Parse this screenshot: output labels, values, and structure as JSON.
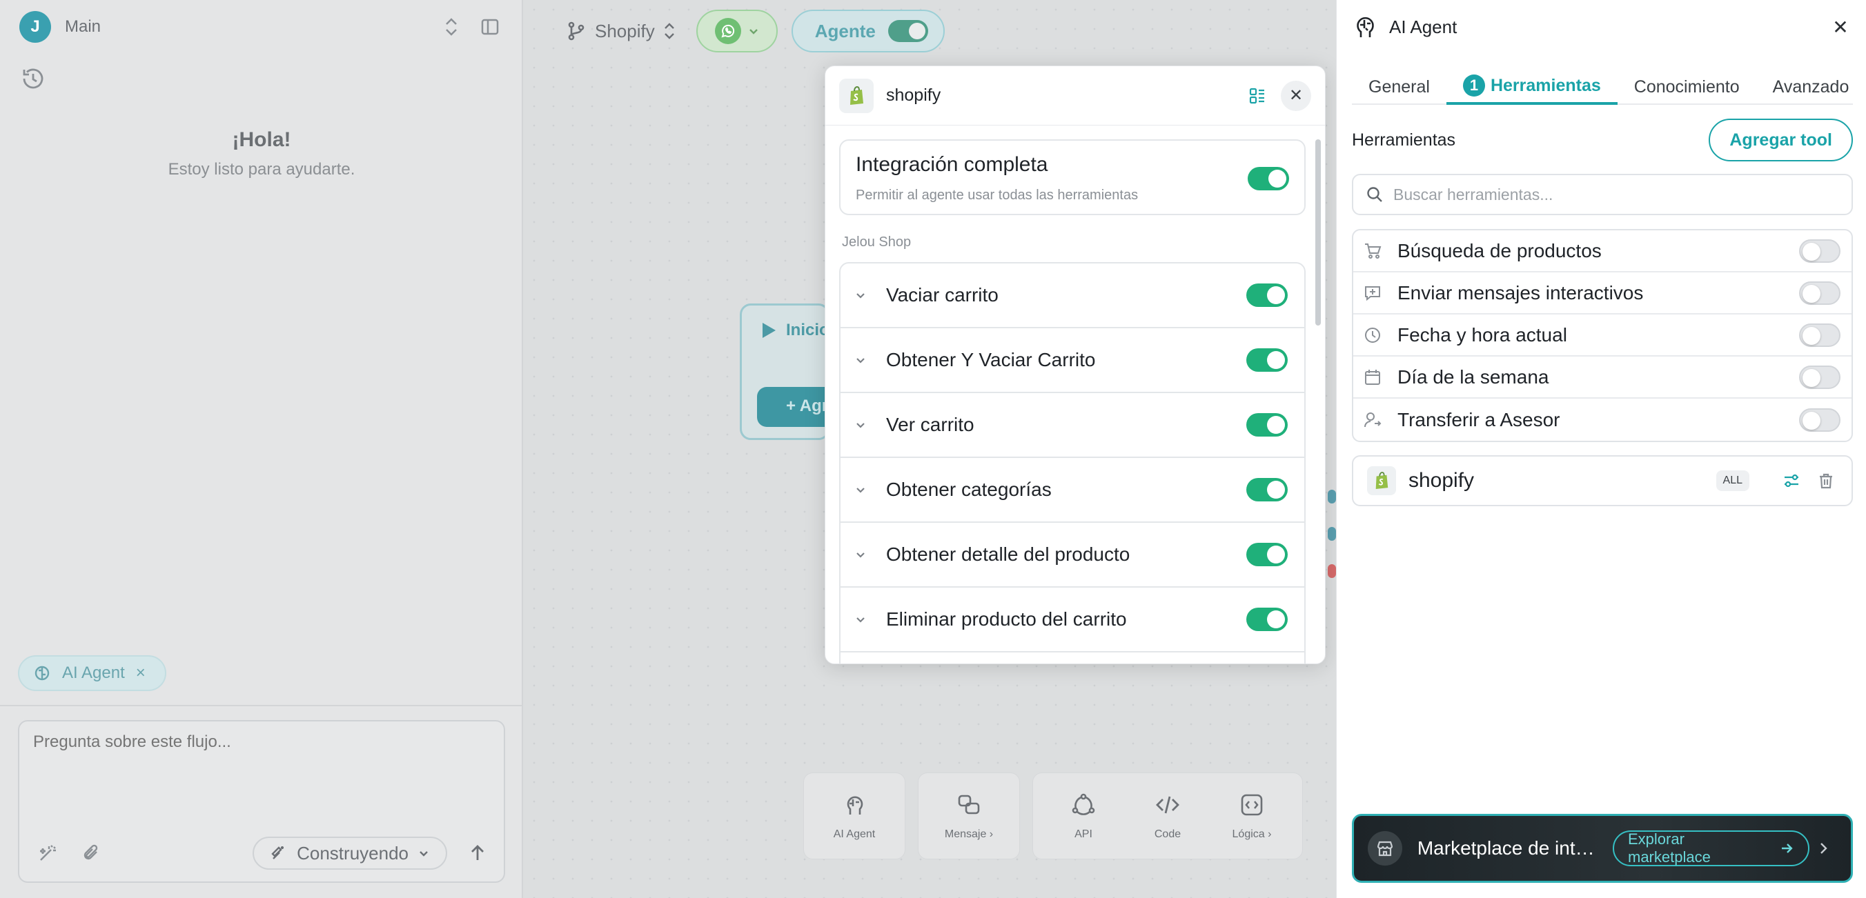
{
  "left_panel": {
    "workspace": "Main",
    "greeting": "¡Hola!",
    "greeting_sub": "Estoy listo para ayudarte.",
    "chip_label": "AI Agent",
    "chip_close": "×",
    "chat_placeholder": "Pregunta sobre este flujo...",
    "mode_label": "Construyendo"
  },
  "top_bar": {
    "flow_name": "Shopify",
    "agent_label": "Agente"
  },
  "canvas": {
    "node_title": "Inicio",
    "node_button": "+ Agregar"
  },
  "bottom_tools": [
    {
      "label": "AI Agent"
    },
    {
      "label": "Mensaje ›"
    },
    {
      "label": "API"
    },
    {
      "label": "Code"
    },
    {
      "label": "Lógica ›"
    }
  ],
  "modal": {
    "title": "shopify",
    "close": "✕",
    "full_integration": {
      "title": "Integración completa",
      "subtitle": "Permitir al agente usar todas las herramientas",
      "enabled": true
    },
    "section_label": "Jelou Shop",
    "tools": [
      {
        "label": "Vaciar carrito",
        "enabled": true
      },
      {
        "label": "Obtener Y Vaciar Carrito",
        "enabled": true
      },
      {
        "label": "Ver carrito",
        "enabled": true
      },
      {
        "label": "Obtener categorías",
        "enabled": true
      },
      {
        "label": "Obtener detalle del producto",
        "enabled": true
      },
      {
        "label": "Eliminar producto del carrito",
        "enabled": true
      }
    ]
  },
  "right_panel": {
    "title": "AI Agent",
    "close": "✕",
    "tabs": [
      {
        "label": "General",
        "active": false
      },
      {
        "label": "Herramientas",
        "active": true,
        "badge": "1"
      },
      {
        "label": "Conocimiento",
        "active": false
      },
      {
        "label": "Avanzado",
        "active": false
      }
    ],
    "tools_label": "Herramientas",
    "add_tool": "Agregar tool",
    "search_placeholder": "Buscar herramientas...",
    "std_tools": [
      {
        "label": "Búsqueda de productos",
        "icon": "cart-icon",
        "enabled": false
      },
      {
        "label": "Enviar mensajes interactivos",
        "icon": "message-plus-icon",
        "enabled": false
      },
      {
        "label": "Fecha y hora actual",
        "icon": "clock-icon",
        "enabled": false
      },
      {
        "label": "Día de la semana",
        "icon": "calendar-icon",
        "enabled": false
      },
      {
        "label": "Transferir a Asesor",
        "icon": "user-transfer-icon",
        "enabled": false
      }
    ],
    "integration": {
      "name": "shopify",
      "badge": "ALL"
    },
    "marketplace": {
      "title": "Marketplace de integraciones",
      "button": "Explorar marketplace"
    }
  },
  "colors": {
    "accent": "#1aa3a8",
    "toggle_on": "#1fb07a",
    "shopify_green": "#95bf47"
  }
}
